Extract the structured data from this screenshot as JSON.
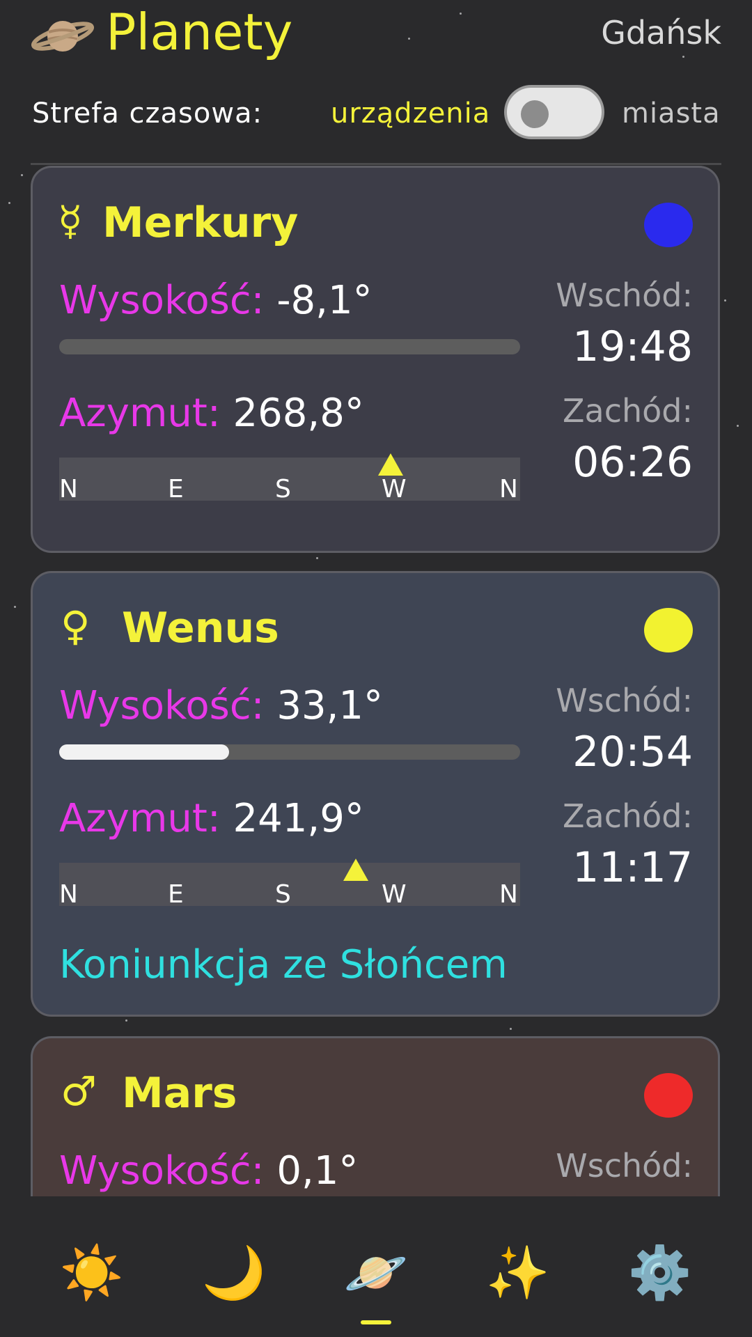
{
  "header": {
    "title": "Planety",
    "city": "Gdańsk"
  },
  "timezone": {
    "label": "Strefa czasowa:",
    "device_option": "urządzenia",
    "city_option": "miasta",
    "toggle_on": false
  },
  "planets": [
    {
      "symbol": "☿",
      "name": "Merkury",
      "color": "#2a2aee",
      "altitude_label": "Wysokość:",
      "altitude_value": "-8,1°",
      "altitude_fraction": 0,
      "azimuth_label": "Azymut:",
      "azimuth_value": "268,8°",
      "azimuth_deg": 268.8,
      "compass": [
        "N",
        "E",
        "S",
        "W",
        "N"
      ],
      "rise_label": "Wschód:",
      "rise_time": "19:48",
      "set_label": "Zachód:",
      "set_time": "06:26"
    },
    {
      "symbol": "♀",
      "name": "Wenus",
      "color": "#f2f230",
      "altitude_label": "Wysokość:",
      "altitude_value": "33,1°",
      "altitude_fraction": 0.368,
      "azimuth_label": "Azymut:",
      "azimuth_value": "241,9°",
      "azimuth_deg": 241.9,
      "compass": [
        "N",
        "E",
        "S",
        "W",
        "N"
      ],
      "rise_label": "Wschód:",
      "rise_time": "20:54",
      "set_label": "Zachód:",
      "set_time": "11:17",
      "note": "Koniunkcja ze Słońcem"
    },
    {
      "symbol": "♂",
      "name": "Mars",
      "color": "#ee2a2a",
      "altitude_label": "Wysokość:",
      "altitude_value": "0,1°",
      "rise_label": "Wschód:"
    }
  ],
  "nav": {
    "items": [
      {
        "icon": "sun-icon",
        "glyph": "☀️"
      },
      {
        "icon": "moon-icon",
        "glyph": "🌙"
      },
      {
        "icon": "planet-icon",
        "glyph": "🪐"
      },
      {
        "icon": "sparkles-icon",
        "glyph": "✨"
      },
      {
        "icon": "gear-icon",
        "glyph": "⚙️"
      }
    ],
    "active_index": 2
  }
}
